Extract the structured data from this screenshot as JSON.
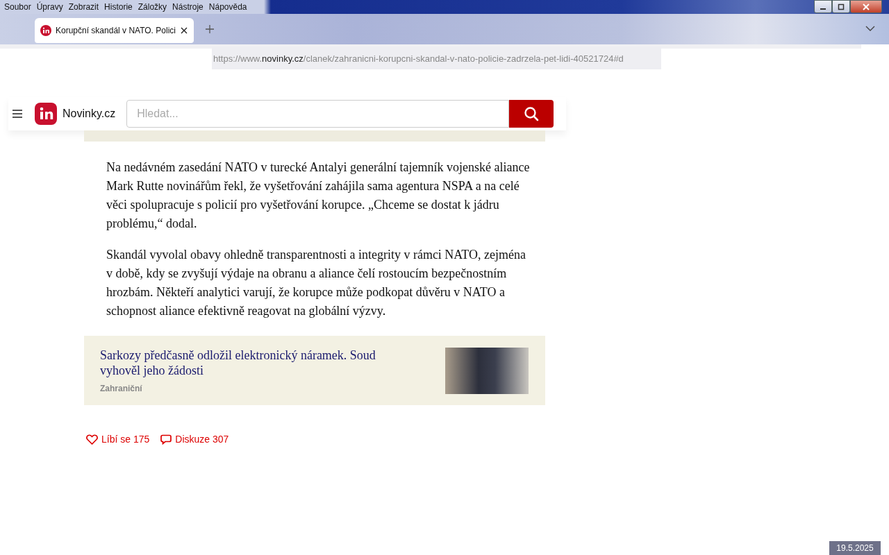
{
  "menu_bar": [
    "Soubor",
    "Úpravy",
    "Zobrazit",
    "Historie",
    "Záložky",
    "Nástroje",
    "Nápověda"
  ],
  "tab": {
    "title": "Korupční skandál v NATO. Polici",
    "selected": true
  },
  "address": {
    "scheme": "https://www.",
    "domain": "novinky.cz",
    "path": "/clanek/zahranicni-korupcni-skandal-v-nato-policie-zadrzela-pet-lidi-40521724#d"
  },
  "header": {
    "site_name": "Novinky.cz",
    "search_placeholder": "Hledat..."
  },
  "paragraphs": [
    "Na nedávném zasedání NATO v turecké Antalyi generální tajemník vojenské aliance Mark Rutte novinářům řekl, že vyšetřování zahájila sama agentura NSPA a na celé věci spolupracuje s policií pro vyšetřování korupce. „Chceme se dostat k jádru problému,“ dodal.",
    "Skandál vyvolal obavy ohledně transparentnosti a integrity v rámci NATO, zejména v době, kdy se zvyšují výdaje na obranu a aliance čelí rostoucím bezpečnostním hrozbám. Někteří analytici varují, že korupce může podkopat důvěru v NATO a schopnost aliance efektivně reagovat na globální výzvy."
  ],
  "related": {
    "title": "Sarkozy předčasně odložil elektronický náramek. Soud vyhověl jeho žádosti",
    "section": "Zahraniční"
  },
  "actions": {
    "likes": "Líbí se 175",
    "comments": "Diskuze 307"
  },
  "taskbar": {
    "date": "19.5.2025"
  }
}
